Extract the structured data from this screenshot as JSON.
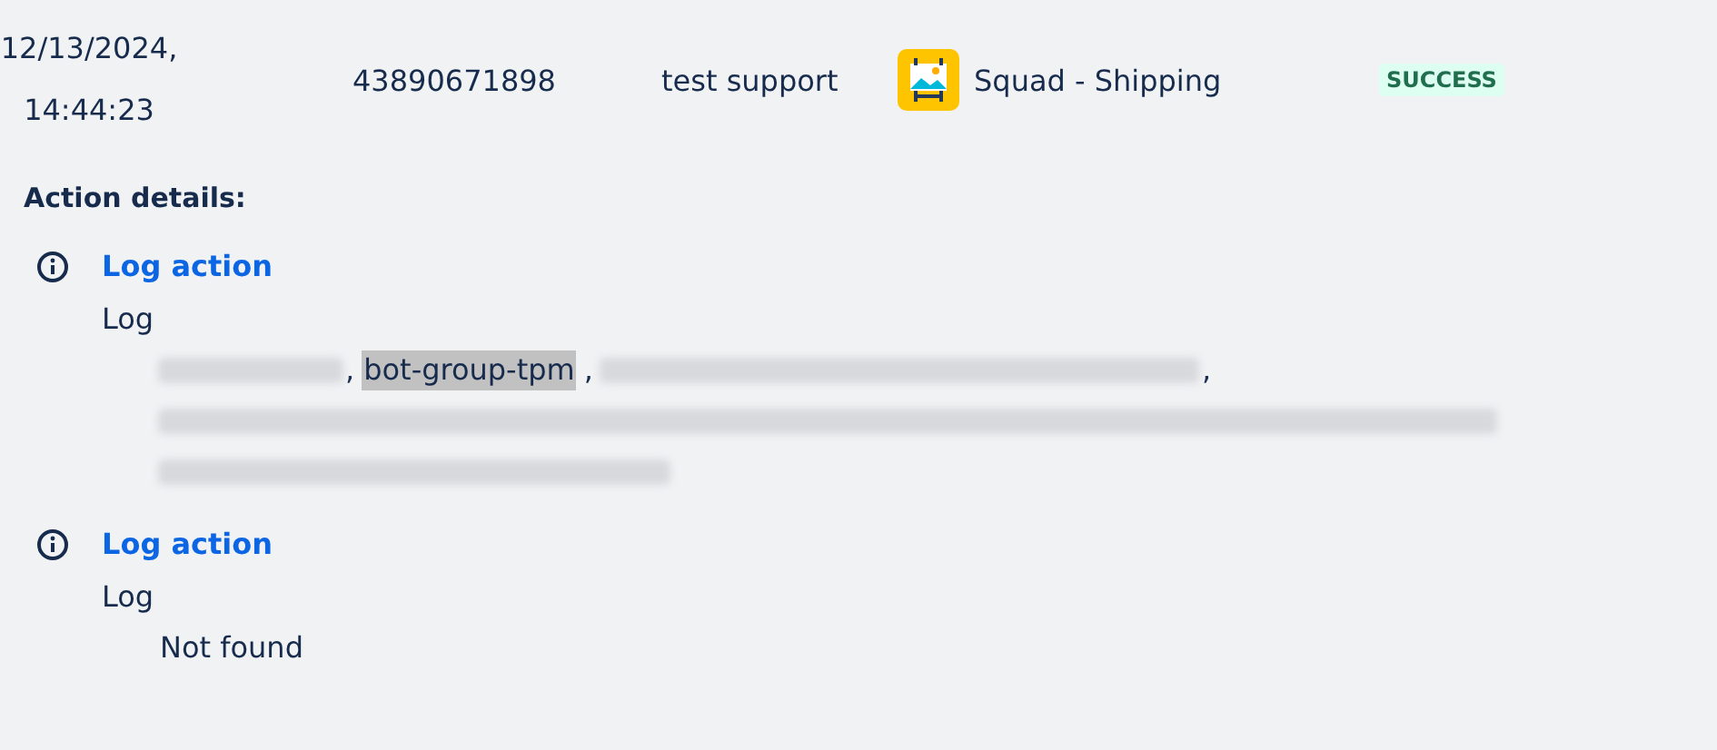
{
  "audit_row": {
    "date": "12/13/2024,",
    "time": "14:44:23",
    "id": "43890671898",
    "actor": "test support",
    "rule": "Squad - Shipping",
    "status": "SUCCESS"
  },
  "details_heading": "Action details:",
  "actions": [
    {
      "title": "Log action",
      "type": "Log",
      "output_lines": [
        [
          {
            "kind": "redacted"
          },
          {
            "kind": "text",
            "text": ",",
            "highlighted": false
          },
          {
            "kind": "text",
            "text": "bot-group-tpm",
            "highlighted": true
          },
          {
            "kind": "text",
            "text": ",",
            "highlighted": false
          },
          {
            "kind": "redacted"
          },
          {
            "kind": "text",
            "text": ",",
            "highlighted": false
          }
        ],
        [
          {
            "kind": "redacted"
          }
        ],
        [
          {
            "kind": "redacted"
          }
        ]
      ]
    },
    {
      "title": "Log action",
      "type": "Log",
      "output_lines": [
        [
          {
            "kind": "text",
            "text": "Not found",
            "highlighted": false
          }
        ]
      ]
    }
  ]
}
